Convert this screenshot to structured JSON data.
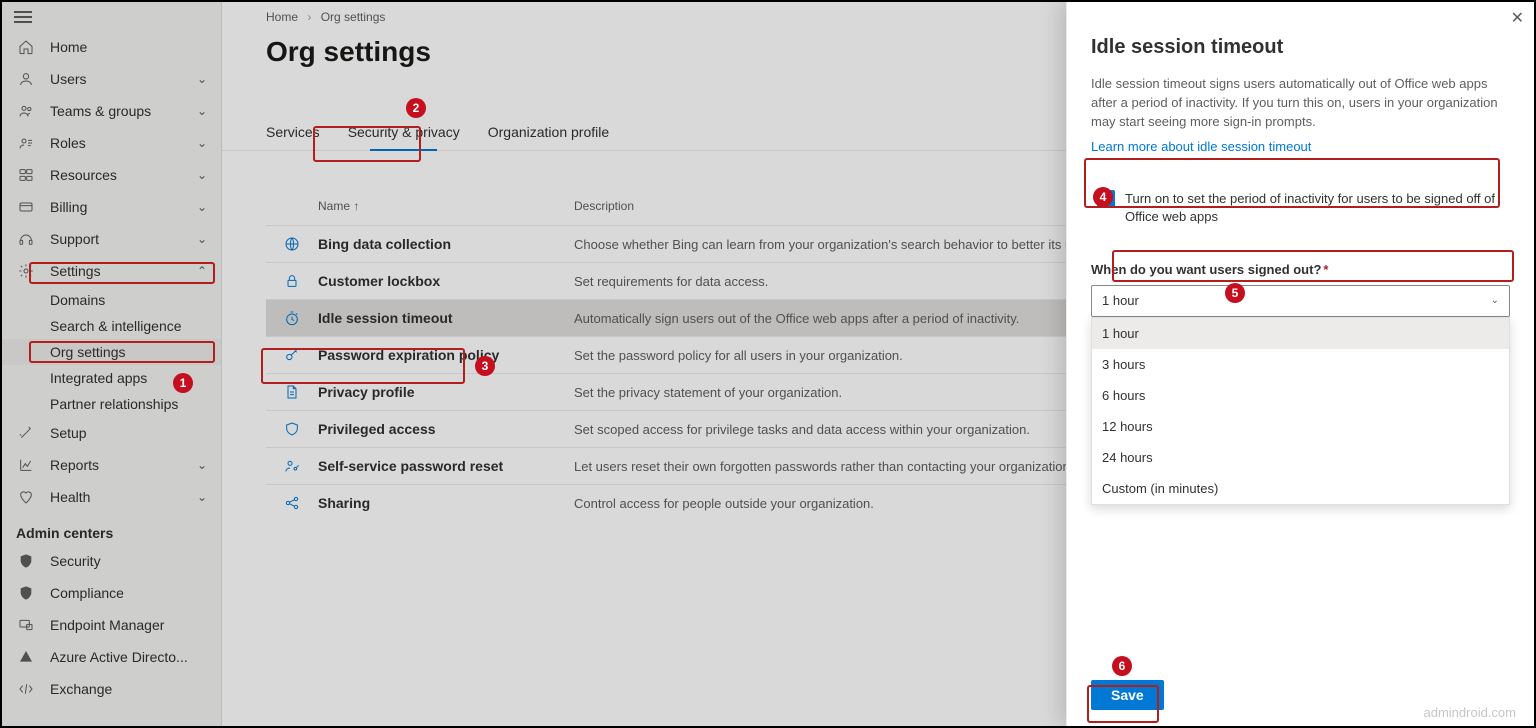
{
  "breadcrumb": {
    "home": "Home",
    "current": "Org settings"
  },
  "page_title": "Org settings",
  "sidebar": {
    "items": [
      {
        "label": "Home"
      },
      {
        "label": "Users"
      },
      {
        "label": "Teams & groups"
      },
      {
        "label": "Roles"
      },
      {
        "label": "Resources"
      },
      {
        "label": "Billing"
      },
      {
        "label": "Support"
      },
      {
        "label": "Settings"
      },
      {
        "label": "Setup"
      },
      {
        "label": "Reports"
      },
      {
        "label": "Health"
      }
    ],
    "settings_sub": [
      {
        "label": "Domains"
      },
      {
        "label": "Search & intelligence"
      },
      {
        "label": "Org settings"
      },
      {
        "label": "Integrated apps"
      },
      {
        "label": "Partner relationships"
      }
    ],
    "admin_header": "Admin centers",
    "admin_centers": [
      {
        "label": "Security"
      },
      {
        "label": "Compliance"
      },
      {
        "label": "Endpoint Manager"
      },
      {
        "label": "Azure Active Directo..."
      },
      {
        "label": "Exchange"
      }
    ]
  },
  "tabs": [
    {
      "label": "Services"
    },
    {
      "label": "Security & privacy"
    },
    {
      "label": "Organization profile"
    }
  ],
  "table": {
    "headers": {
      "name": "Name",
      "sort": "↑",
      "desc": "Description"
    },
    "rows": [
      {
        "name": "Bing data collection",
        "desc": "Choose whether Bing can learn from your organization's search behavior to better its results."
      },
      {
        "name": "Customer lockbox",
        "desc": "Set requirements for data access."
      },
      {
        "name": "Idle session timeout",
        "desc": "Automatically sign users out of the Office web apps after a period of inactivity."
      },
      {
        "name": "Password expiration policy",
        "desc": "Set the password policy for all users in your organization."
      },
      {
        "name": "Privacy profile",
        "desc": "Set the privacy statement of your organization."
      },
      {
        "name": "Privileged access",
        "desc": "Set scoped access for privilege tasks and data access within your organization."
      },
      {
        "name": "Self-service password reset",
        "desc": "Let users reset their own forgotten passwords rather than contacting your organization's IT for help."
      },
      {
        "name": "Sharing",
        "desc": "Control access for people outside your organization."
      }
    ]
  },
  "panel": {
    "title": "Idle session timeout",
    "desc": "Idle session timeout signs users automatically out of Office web apps after a period of inactivity. If you turn this on, users in your organization may start seeing more sign-in prompts.",
    "link": "Learn more about idle session timeout",
    "checkbox_label": "Turn on to set the period of inactivity for users to be signed off of Office web apps",
    "field_label": "When do you want users signed out?",
    "selected": "1 hour",
    "options": [
      "1 hour",
      "3 hours",
      "6 hours",
      "12 hours",
      "24 hours",
      "Custom (in minutes)"
    ],
    "save": "Save"
  },
  "watermark": "admindroid.com",
  "annotations": {
    "1": "1",
    "2": "2",
    "3": "3",
    "4": "4",
    "5": "5",
    "6": "6"
  }
}
